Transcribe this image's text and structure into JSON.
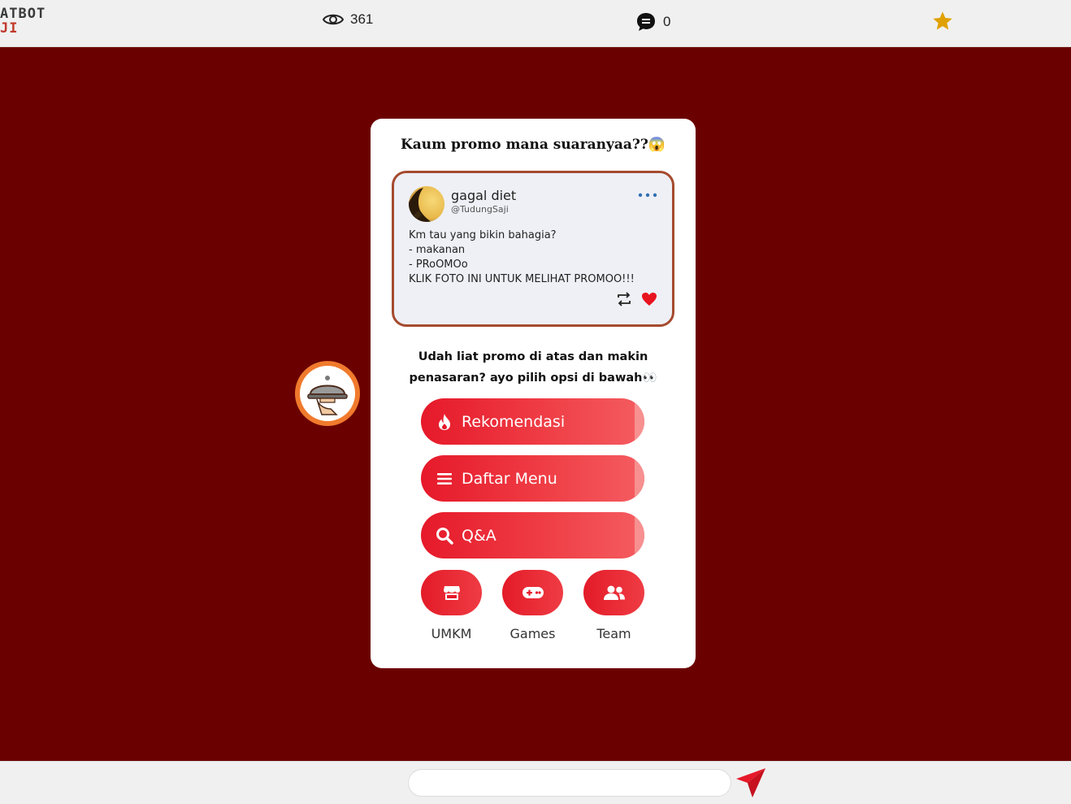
{
  "topbar": {
    "logo_line1": "ATBOT",
    "logo_line2": "JI",
    "views_count": "361",
    "comments_count": "0"
  },
  "card": {
    "title": "Kaum promo mana suaranyaa??😱",
    "tweet": {
      "name": "gagal diet",
      "handle": "@TudungSaji",
      "lines": [
        "Km tau yang bikin bahagia?",
        "- makanan",
        "- PRoOMOo",
        "KLIK FOTO INI UNTUK MELIHAT PROMOO!!!"
      ]
    },
    "prompt": "Udah liat promo di atas dan makin penasaran? ayo pilih opsi di bawah👀",
    "buttons": [
      {
        "label": "Rekomendasi",
        "icon": "fire-icon"
      },
      {
        "label": "Daftar Menu",
        "icon": "menu-icon"
      },
      {
        "label": "Q&A",
        "icon": "search-icon"
      }
    ],
    "shortcuts": [
      {
        "label": "UMKM",
        "icon": "store-icon"
      },
      {
        "label": "Games",
        "icon": "gamepad-icon"
      },
      {
        "label": "Team",
        "icon": "users-icon"
      }
    ]
  },
  "chat": {
    "input_value": "",
    "placeholder": ""
  },
  "colors": {
    "background": "#6b0000",
    "accent": "#e6192a",
    "star": "#e0a000",
    "avatar_ring": "#f07a2d"
  }
}
